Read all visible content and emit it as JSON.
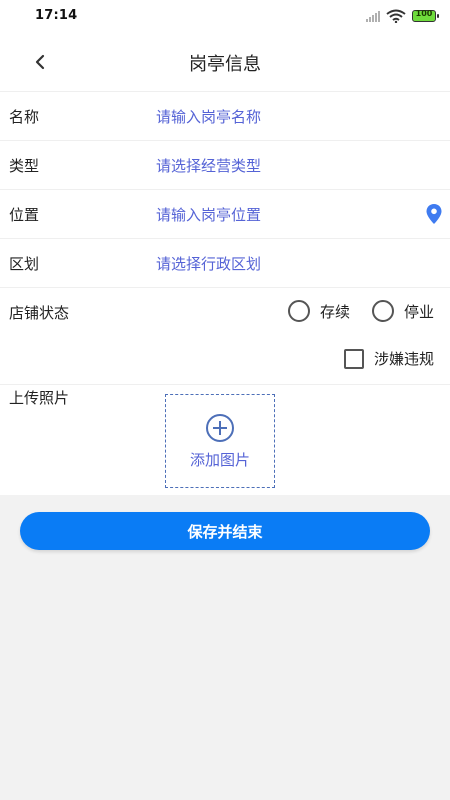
{
  "status_bar": {
    "time": "17:14",
    "battery": "100"
  },
  "nav": {
    "title": "岗亭信息",
    "back_icon": "chevron-left-icon"
  },
  "form": {
    "name": {
      "label": "名称",
      "placeholder": "请输入岗亭名称"
    },
    "type": {
      "label": "类型",
      "placeholder": "请选择经营类型"
    },
    "location": {
      "label": "位置",
      "placeholder": "请输入岗亭位置",
      "icon": "location-pin-icon"
    },
    "district": {
      "label": "区划",
      "placeholder": "请选择行政区划"
    },
    "shop_status": {
      "label": "店铺状态",
      "options": [
        "存续",
        "停业"
      ],
      "selected": null
    },
    "violation": {
      "label": "涉嫌违规",
      "checked": false
    },
    "upload": {
      "label": "上传照片",
      "add_text": "添加图片"
    }
  },
  "actions": {
    "save_label": "保存并结束"
  },
  "colors": {
    "accent": "#0a7cf5",
    "placeholder_text": "#5563d6",
    "location_icon": "#3f7bf0",
    "background": "#f2f2f2"
  }
}
